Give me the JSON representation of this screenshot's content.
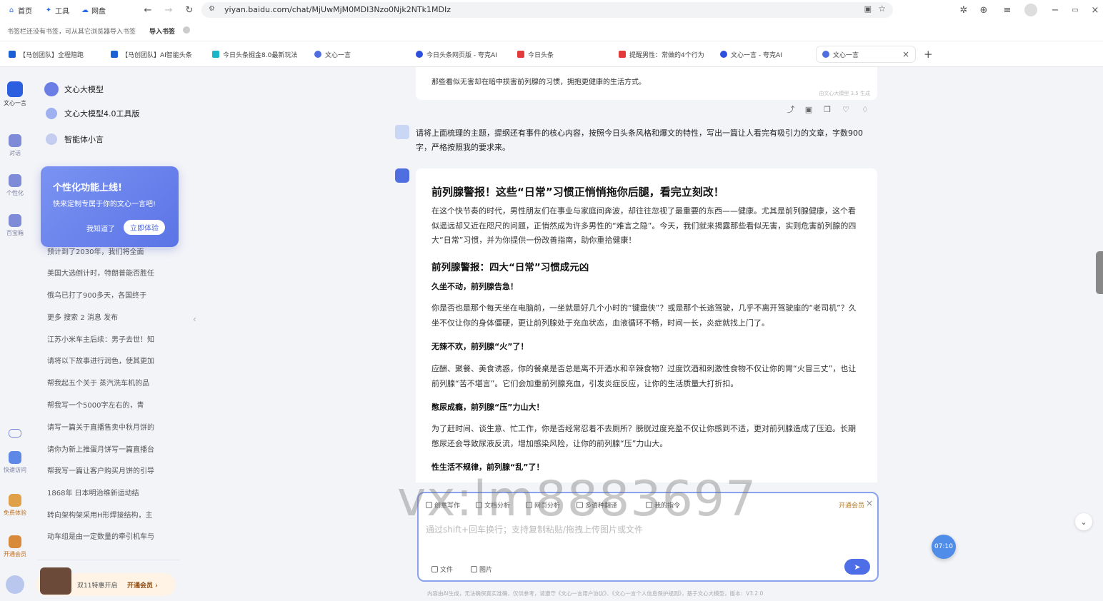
{
  "browser": {
    "nav": [
      {
        "label": "首页",
        "icon": "home-icon"
      },
      {
        "label": "工具",
        "icon": "tools-icon"
      },
      {
        "label": "网盘",
        "icon": "cloud-drive-icon"
      }
    ],
    "url": "yiyan.baidu.com/chat/MjUwMjM0MDI3Nzo0Njk2NTk1MDIz"
  },
  "bookmarks": {
    "hint": "书签栏还没有书签，可从其它浏览器导入书签",
    "import_label": "导入书签"
  },
  "tabs": [
    {
      "label": "【马创团队】全程陪跑",
      "color": "#1a5fd6"
    },
    {
      "label": "【马创团队】AI智能头条",
      "color": "#1a5fd6"
    },
    {
      "label": "今日头条掘金8.0最新玩法",
      "color": "#19b5c8"
    },
    {
      "label": "文心一言",
      "color": "#4f6fe0"
    },
    {
      "label": "今日头条网页版 - 夸克AI",
      "color": "#2d4fe0"
    },
    {
      "label": "今日头条",
      "color": "#e33b3b"
    },
    {
      "label": "提醒男性：常做的4个行为",
      "color": "#e33b3b"
    },
    {
      "label": "文心一言 - 夸克AI",
      "color": "#2d4fe0"
    },
    {
      "label": "文心一言",
      "color": "#4f6fe0"
    }
  ],
  "rail": [
    {
      "label": "文心一言"
    },
    {
      "label": "对话"
    },
    {
      "label": "个性化"
    },
    {
      "label": "百宝箱"
    },
    {
      "label": "快速访问"
    },
    {
      "label": "免费体验"
    },
    {
      "label": "开通会员"
    }
  ],
  "sidebar": {
    "menu": [
      {
        "label": "文心大模型"
      },
      {
        "label": "文心大模型4.0工具版"
      },
      {
        "label": "智能体小言"
      }
    ],
    "history": [
      "预计到了2030年，我们将全面",
      "美国大选倒计时，特朗普能否胜任",
      "俄乌已打了900多天，各国终于",
      "更多 搜索 2 消息 发布",
      "江苏小米车主后续：男子去世！知",
      "请将以下故事进行润色，使其更加",
      "帮我起五个关于 蒸汽洗车机的品",
      "帮我写一个5000字左右的，青",
      "请写一篇关于直播售卖中秋月饼的",
      "请你为新上推蛋月饼写一篇直播台",
      "帮我写一篇让客户购买月饼的引导",
      "1868年 日本明治维新运动结",
      "转向架构架采用H形焊接结构，主",
      "动车组是由一定数量的牵引机车与"
    ],
    "popup": {
      "title": "个性化功能上线!",
      "desc": "快来定制专属于你的文心一言吧!",
      "dismiss": "我知道了",
      "try": "立即体验"
    },
    "promo": {
      "text": "双11特惠开启",
      "cta": "开通会员 ›"
    }
  },
  "chat": {
    "prev_text": "那些看似无害却在暗中损害前列腺的习惯，拥抱更健康的生活方式。",
    "prev_tag": "由文心大模型 3.5 生成",
    "user_message": "请将上面梳理的主题，提纲还有事件的核心内容，按照今日头条风格和爆文的特性，写出一篇让人看完有吸引力的文章，字数900字，严格按照我的要求来。",
    "answer": {
      "title": "前列腺警报！这些“日常”习惯正悄悄拖你后腿，看完立刻改！",
      "intro": "在这个快节奏的时代，男性朋友们在事业与家庭间奔波，却往往忽视了最重要的东西——健康。尤其是前列腺健康，这个看似遥远却又近在咫尺的问题，正悄然成为许多男性的“难言之隐”。今天，我们就来揭露那些看似无害，实则危害前列腺的四大“日常”习惯，并为你提供一份改善指南，助你重拾健康！",
      "section": "前列腺警报：四大“日常”习惯成元凶",
      "h1": "久坐不动，前列腺告急！",
      "p1": "你是否也是那个每天坐在电脑前，一坐就是好几个小时的“键盘侠”？或是那个长途驾驶，几乎不离开驾驶座的“老司机”？久坐不仅让你的身体僵硬，更让前列腺处于充血状态，血液循环不畅，时间一长，炎症就找上门了。",
      "h2": "无辣不欢，前列腺“火”了！",
      "p2": "应酬、聚餐、美食诱惑，你的餐桌是否总是离不开酒水和辛辣食物？过度饮酒和刺激性食物不仅让你的胃“火冒三丈”，也让前列腺“苦不堪言”。它们会加重前列腺充血，引发炎症反应，让你的生活质量大打折扣。",
      "h3": "憋尿成瘾，前列腺“压”力山大！",
      "p3": "为了赶时间、谈生意、忙工作，你是否经常忍着不去厕所？膀胱过度充盈不仅让你感到不适，更对前列腺造成了压迫。长期憋尿还会导致尿液反流，增加感染风险，让你的前列腺“压”力山大。",
      "h4": "性生活不规律，前列腺“乱”了！"
    }
  },
  "input": {
    "tools": [
      "创意写作",
      "文档分析",
      "网页分析",
      "多语种翻译",
      "我的指令"
    ],
    "member": "开通会员",
    "placeholder": "通过shift+回车换行；支持复制粘贴/拖拽上传图片或文件",
    "attach": [
      "文件",
      "图片"
    ]
  },
  "footer": "内容由AI生成，无法确保真实准确，仅供参考，请遵守《文心一言用户协议》、《文心一言个人信息保护规则》，基于文心大模型，版本：V3.2.0",
  "watermark": "vx:lm8883697",
  "timer": "07:10"
}
